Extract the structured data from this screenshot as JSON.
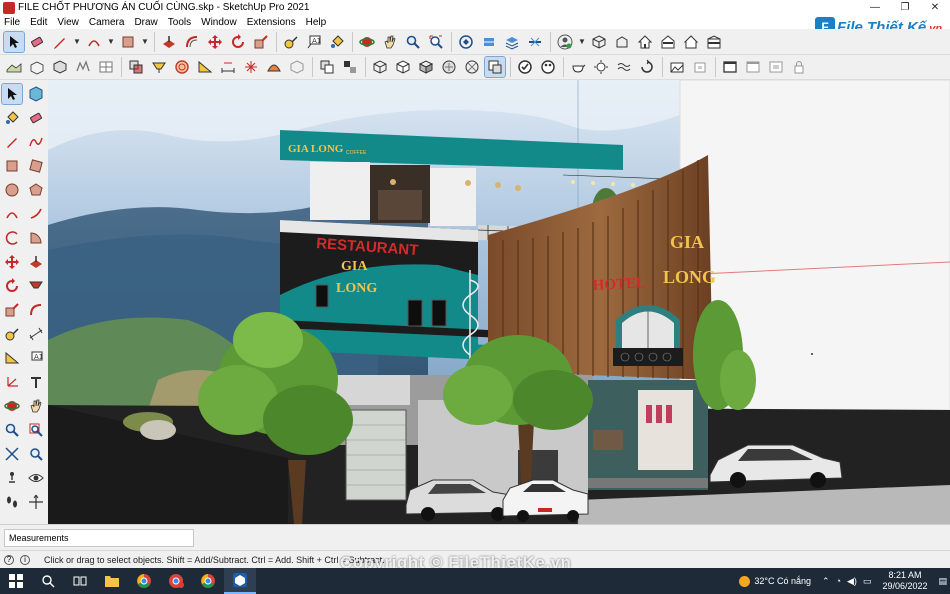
{
  "window": {
    "title": "FILE CHỐT PHƯƠNG ÁN CUỐI CÙNG.skp - SketchUp Pro 2021",
    "controls": {
      "minimize": "—",
      "maximize": "❐",
      "close": "✕"
    }
  },
  "menu": [
    "File",
    "Edit",
    "View",
    "Camera",
    "Draw",
    "Tools",
    "Window",
    "Extensions",
    "Help"
  ],
  "logo": {
    "prefix": "File",
    "main": "Thiết Kế",
    "suffix": ".vn"
  },
  "scene": {
    "signs": {
      "coffee": "GIA LONG",
      "coffee_small": "COFFEE",
      "restaurant_line1": "RESTAURANT",
      "restaurant_line2": "GIA",
      "restaurant_line3": "LONG",
      "hotel": "HOTEL",
      "hotel_name": "LONG",
      "hotel_top": "GIA"
    }
  },
  "measurements": {
    "label": "Measurements"
  },
  "status": {
    "text": "Click or drag to select objects. Shift = Add/Subtract. Ctrl = Add. Shift + Ctrl = Subtract."
  },
  "watermark": "Copyright © FileThietKe.vn",
  "taskbar": {
    "weather": "32°C  Có nắng",
    "time": "8:21 AM",
    "date": "29/06/2022"
  },
  "colors": {
    "accent": "#1b7fc4",
    "teal": "#138a8a",
    "sign_red": "#d42a2a"
  }
}
